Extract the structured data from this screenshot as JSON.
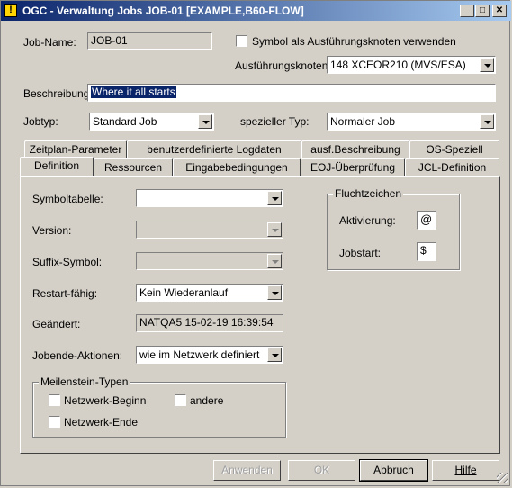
{
  "window": {
    "title": "OGC - Verwaltung Jobs JOB-01 [EXAMPLE,B60-FLOW]",
    "icon": "!",
    "controls": [
      "_",
      "□",
      "✕"
    ]
  },
  "form": {
    "jobname_label": "Job-Name:",
    "jobname_value": "JOB-01",
    "symbol_checkbox_label": "Symbol als Ausführungsknoten verwenden",
    "symbol_checked": false,
    "node_label": "Ausführungsknoten:",
    "node_value": "148   XCEOR210 (MVS/ESA)",
    "description_label": "Beschreibung:",
    "description_value": "Where it all starts",
    "jobtype_label": "Jobtyp:",
    "jobtype_value": "Standard Job",
    "special_label": "spezieller Typ:",
    "special_value": "Normaler Job"
  },
  "tabs_back": [
    "Zeitplan-Parameter",
    "benutzerdefinierte Logdaten",
    "ausf.Beschreibung",
    "OS-Speziell"
  ],
  "tabs_front": [
    "Definition",
    "Ressourcen",
    "Eingabebedingungen",
    "EOJ-Überprüfung",
    "JCL-Definition"
  ],
  "definition": {
    "symboltable_label": "Symboltabelle:",
    "symboltable_value": "",
    "version_label": "Version:",
    "version_value": "",
    "suffix_label": "Suffix-Symbol:",
    "suffix_value": "",
    "restart_label": "Restart-fähig:",
    "restart_value": "Kein Wiederanlauf",
    "changed_label": "Geändert:",
    "changed_value": "NATQA5 15-02-19 16:39:54",
    "jobend_label": "Jobende-Aktionen:",
    "jobend_value": "wie im Netzwerk definiert"
  },
  "escape": {
    "title": "Fluchtzeichen",
    "activation_label": "Aktivierung:",
    "activation_value": "@",
    "jobstart_label": "Jobstart:",
    "jobstart_value": "$"
  },
  "milestones": {
    "title": "Meilenstein-Typen",
    "network_begin": "Netzwerk-Beginn",
    "other": "andere",
    "network_end": "Netzwerk-Ende"
  },
  "buttons": {
    "apply": "Anwenden",
    "ok": "OK",
    "cancel": "Abbruch",
    "help": "Hilfe"
  }
}
